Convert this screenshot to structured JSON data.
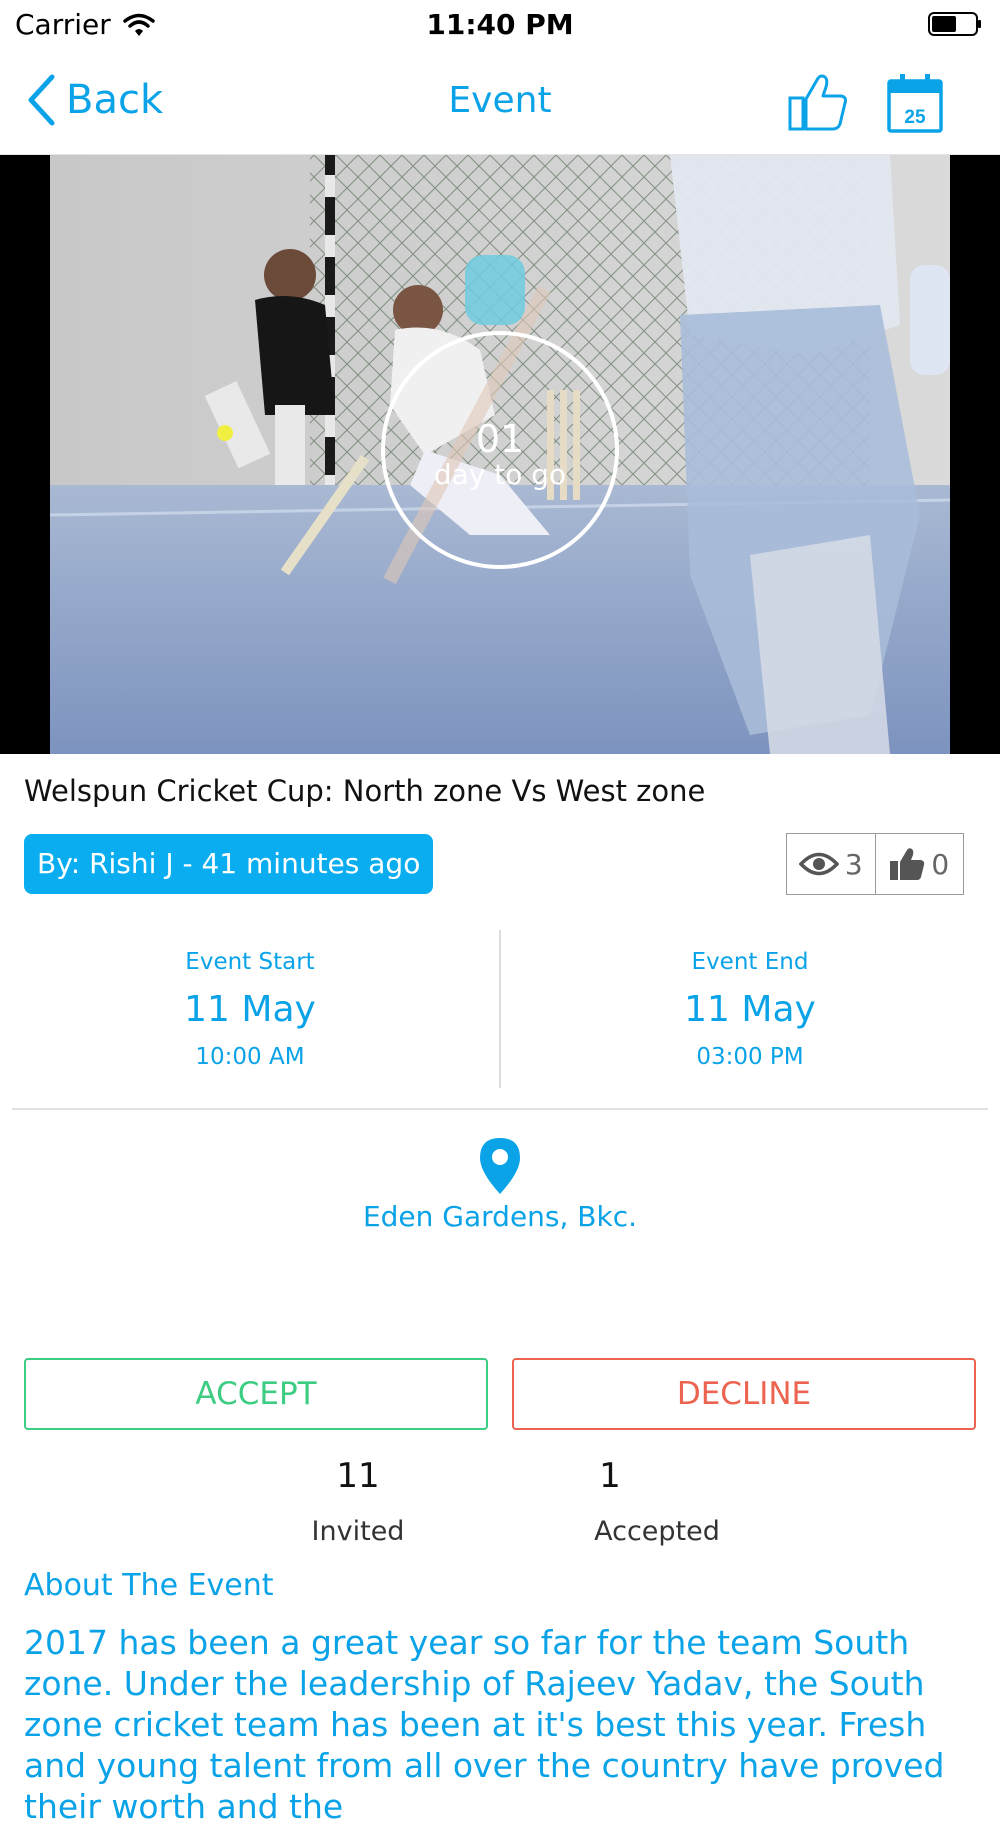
{
  "status_bar": {
    "carrier": "Carrier",
    "time": "11:40 PM"
  },
  "nav": {
    "back_label": "Back",
    "title": "Event",
    "calendar_day": "25"
  },
  "hero": {
    "countdown_number": "01",
    "countdown_label": "day to go"
  },
  "event": {
    "title": "Welspun Cricket Cup: North zone Vs West zone",
    "author": "By: Rishi J - 41 minutes ago",
    "views": "3",
    "likes": "0"
  },
  "dates": {
    "start": {
      "label": "Event Start",
      "day": "11 May",
      "time": "10:00 AM"
    },
    "end": {
      "label": "Event End",
      "day": "11 May",
      "time": "03:00 PM"
    }
  },
  "location": "Eden Gardens, Bkc.",
  "actions": {
    "accept_label": "ACCEPT",
    "decline_label": "DECLINE"
  },
  "counts": {
    "invited": {
      "value": "11",
      "label": "Invited"
    },
    "accepted": {
      "value": "1",
      "label": "Accepted"
    }
  },
  "about": {
    "heading": "About The Event",
    "body": "2017 has been a great year so far for the team South zone. Under the leadership of Rajeev Yadav, the South zone cricket team has been at it's best this year. Fresh and young talent from all over the country have proved their worth and the"
  },
  "colors": {
    "accent": "#0aa3e8",
    "badge": "#0aaef0",
    "accept": "#3ccd82",
    "decline": "#ec6450"
  },
  "icons": [
    "wifi-icon",
    "battery-icon",
    "chevron-left-icon",
    "thumbs-up-icon",
    "calendar-icon",
    "eye-icon",
    "location-pin-icon"
  ]
}
